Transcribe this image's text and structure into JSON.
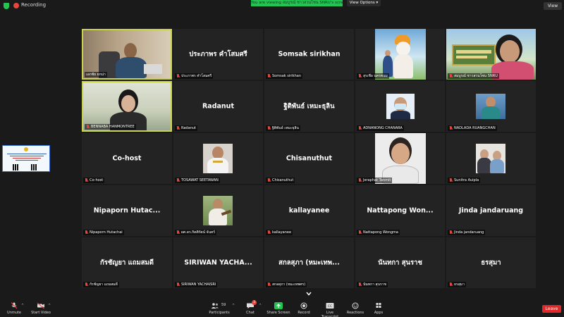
{
  "topbar": {
    "recording_label": "Recording",
    "viewing_banner": "You are viewing สมบูรณ์ ชาวสวนโซน SNRU's screen",
    "view_options": "View Options ▾",
    "view_button": "View"
  },
  "tiles": [
    {
      "center": "",
      "label": "เอกชัย ยกน่า",
      "muted": false
    },
    {
      "center": "ประภาพร คำโสมศรี",
      "label": "ประภาพร คำโสมศรี",
      "muted": true
    },
    {
      "center": "Somsak sirikhan",
      "label": "Somsak sirikhan",
      "muted": true
    },
    {
      "center": "",
      "label": "สุรเชีย นครพนม",
      "muted": true
    },
    {
      "center": "",
      "label": "สมบูรณ์ ชาวสวนโซน SNRU",
      "muted": true
    },
    {
      "center": "",
      "label": "BENNABA HANMONTREE",
      "muted": true
    },
    {
      "center": "Radanut",
      "label": "Radanut",
      "muted": true
    },
    {
      "center": "ฐิติพันธ์ เหมะธุลิน",
      "label": "ฐิติพันธ์ เหมะธุลิน",
      "muted": true
    },
    {
      "center": "",
      "label": "ADNANONG CHANARA",
      "muted": true
    },
    {
      "center": "",
      "label": "NADLADA RUANGCHAN",
      "muted": true
    },
    {
      "center": "Co-host",
      "label": "Co-host",
      "muted": true
    },
    {
      "center": "",
      "label": "TOSAWAT SEETAWAN",
      "muted": true
    },
    {
      "center": "Chisanuthut",
      "label": "Chisanuthut",
      "muted": true
    },
    {
      "center": "",
      "label": "Jeraphat Tanmit",
      "muted": true
    },
    {
      "center": "",
      "label": "Sunitra Auipla",
      "muted": true
    },
    {
      "center": "Nipaporn Hutac...",
      "label": "Nipaporn Hutachai",
      "muted": true
    },
    {
      "center": "",
      "label": "ผศ.ดร.กิตติรัตน์ จันทร์",
      "muted": true
    },
    {
      "center": "kallayanee",
      "label": "kallayanee",
      "muted": true
    },
    {
      "center": "Nattapong Won...",
      "label": "Nattapong Wongma",
      "muted": true
    },
    {
      "center": "Jinda jandaruang",
      "label": "Jinda jandaruang",
      "muted": true
    },
    {
      "center": "กัรชัญยา แถมสมดี",
      "label": "กัรชัญยา แถมสมดี",
      "muted": true
    },
    {
      "center": "SIRIWAN YACHA...",
      "label": "SIRIWAN YACHAISRI",
      "muted": true
    },
    {
      "center": "สกลสุภา (หมะเทพ...",
      "label": "สกลสุภา (หมะเทพศร)",
      "muted": true
    },
    {
      "center": "นันทกา สุนราช",
      "label": "นันทกา สุนราช",
      "muted": true
    },
    {
      "center": "ธรสุมา",
      "label": "ธรสุมา",
      "muted": true
    }
  ],
  "toolbar": {
    "unmute": "Unmute",
    "start_video": "Start Video",
    "participants": "Participants",
    "participant_count": "59",
    "chat": "Chat",
    "chat_badge": "3",
    "share_screen": "Share Screen",
    "record": "Record",
    "live_transcript": "Live Transcript",
    "reactions": "Reactions",
    "apps": "Apps",
    "leave": "Leave"
  },
  "colors": {
    "banner": "#23c552",
    "leave": "#e02828",
    "active_border": "#c9d44a",
    "tile_bg": "#232323",
    "muted": "#e8453c"
  }
}
